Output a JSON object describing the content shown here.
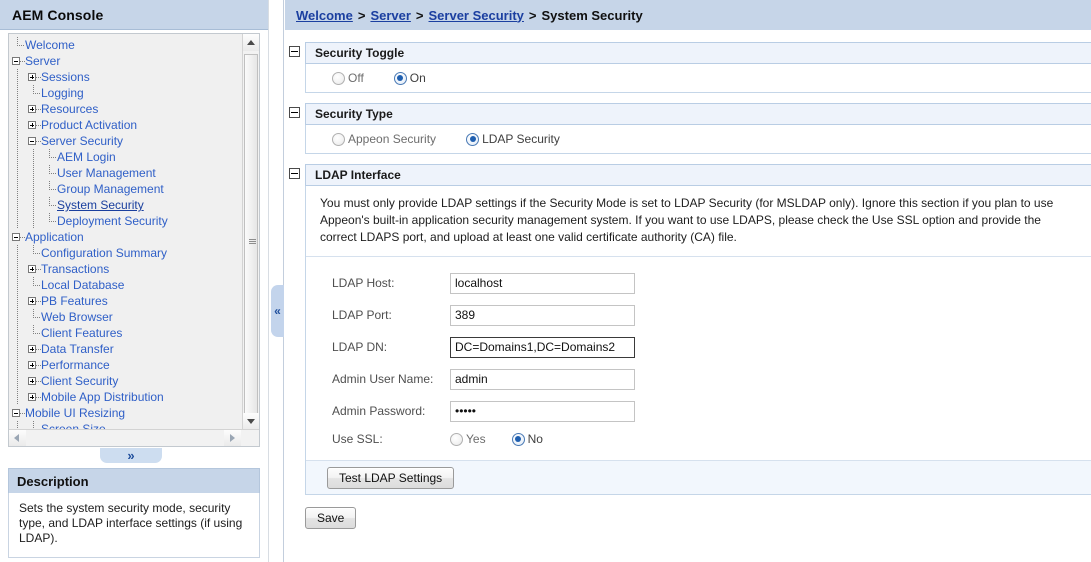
{
  "left_panel": {
    "header_title": "AEM Console",
    "tree": [
      {
        "label": "Welcome",
        "depth": 0,
        "toggle": "none",
        "selected": false
      },
      {
        "label": "Server",
        "depth": 0,
        "toggle": "minus",
        "selected": false
      },
      {
        "label": "Sessions",
        "depth": 1,
        "toggle": "plus",
        "selected": false
      },
      {
        "label": "Logging",
        "depth": 1,
        "toggle": "none",
        "selected": false
      },
      {
        "label": "Resources",
        "depth": 1,
        "toggle": "plus",
        "selected": false
      },
      {
        "label": "Product Activation",
        "depth": 1,
        "toggle": "plus",
        "selected": false
      },
      {
        "label": "Server Security",
        "depth": 1,
        "toggle": "minus",
        "selected": false
      },
      {
        "label": "AEM Login",
        "depth": 2,
        "toggle": "none",
        "selected": false
      },
      {
        "label": "User Management",
        "depth": 2,
        "toggle": "none",
        "selected": false
      },
      {
        "label": "Group Management",
        "depth": 2,
        "toggle": "none",
        "selected": false
      },
      {
        "label": "System Security",
        "depth": 2,
        "toggle": "none",
        "selected": true
      },
      {
        "label": "Deployment Security",
        "depth": 2,
        "toggle": "none",
        "selected": false
      },
      {
        "label": "Application",
        "depth": 0,
        "toggle": "minus",
        "selected": false
      },
      {
        "label": "Configuration Summary",
        "depth": 1,
        "toggle": "none",
        "selected": false
      },
      {
        "label": "Transactions",
        "depth": 1,
        "toggle": "plus",
        "selected": false
      },
      {
        "label": "Local Database",
        "depth": 1,
        "toggle": "none",
        "selected": false
      },
      {
        "label": "PB Features",
        "depth": 1,
        "toggle": "plus",
        "selected": false
      },
      {
        "label": "Web Browser",
        "depth": 1,
        "toggle": "none",
        "selected": false
      },
      {
        "label": "Client Features",
        "depth": 1,
        "toggle": "none",
        "selected": false
      },
      {
        "label": "Data Transfer",
        "depth": 1,
        "toggle": "plus",
        "selected": false
      },
      {
        "label": "Performance",
        "depth": 1,
        "toggle": "plus",
        "selected": false
      },
      {
        "label": "Client Security",
        "depth": 1,
        "toggle": "plus",
        "selected": false
      },
      {
        "label": "Mobile App Distribution",
        "depth": 1,
        "toggle": "plus",
        "selected": false
      },
      {
        "label": "Mobile UI Resizing",
        "depth": 0,
        "toggle": "minus",
        "selected": false
      },
      {
        "label": "Screen Size",
        "depth": 1,
        "toggle": "none",
        "selected": false
      }
    ],
    "expand_handle_icon": "chevron-double-down-icon",
    "description": {
      "title": "Description",
      "text": "Sets the system security mode, security type, and LDAP interface settings (if using LDAP)."
    }
  },
  "splitter": {
    "collapse_icon": "chevron-double-left-icon"
  },
  "right_panel": {
    "breadcrumb": {
      "items": [
        "Welcome",
        "Server",
        "Server Security"
      ],
      "separator": ">",
      "current": "System Security"
    },
    "security_toggle": {
      "title": "Security Toggle",
      "options": [
        {
          "label": "Off",
          "checked": false
        },
        {
          "label": "On",
          "checked": true
        }
      ]
    },
    "security_type": {
      "title": "Security Type",
      "options": [
        {
          "label": "Appeon Security",
          "checked": false
        },
        {
          "label": "LDAP Security",
          "checked": true
        }
      ]
    },
    "ldap_interface": {
      "title": "LDAP Interface",
      "note": "You must only provide LDAP settings if the Security Mode is set to LDAP Security (for MSLDAP only). Ignore this section if you plan to use Appeon's built-in application security management system. If you want to use LDAPS, please check the Use SSL option and provide the correct LDAPS port, and upload at least one valid certificate authority (CA) file.",
      "fields": [
        {
          "label": "LDAP Host:",
          "value": "localhost",
          "type": "text",
          "focused": false,
          "name": "ldap-host"
        },
        {
          "label": "LDAP Port:",
          "value": "389",
          "type": "text",
          "focused": false,
          "name": "ldap-port"
        },
        {
          "label": "LDAP DN:",
          "value": "DC=Domains1,DC=Domains2",
          "type": "text",
          "focused": true,
          "name": "ldap-dn"
        },
        {
          "label": "Admin User Name:",
          "value": "admin",
          "type": "text",
          "focused": false,
          "name": "admin-user-name"
        },
        {
          "label": "Admin Password:",
          "value": "•••••",
          "type": "password",
          "focused": false,
          "name": "admin-password"
        }
      ],
      "use_ssl": {
        "label": "Use SSL:",
        "options": [
          {
            "label": "Yes",
            "checked": false
          },
          {
            "label": "No",
            "checked": true
          }
        ]
      },
      "test_button": "Test LDAP Settings"
    },
    "save_button": "Save"
  },
  "colors": {
    "header_blue": "#c6d5e8",
    "section_head": "#eef3fb",
    "link_blue": "#1b3fa0",
    "tree_link": "#2f5fc7",
    "radio_dot": "#1f5fb0"
  }
}
